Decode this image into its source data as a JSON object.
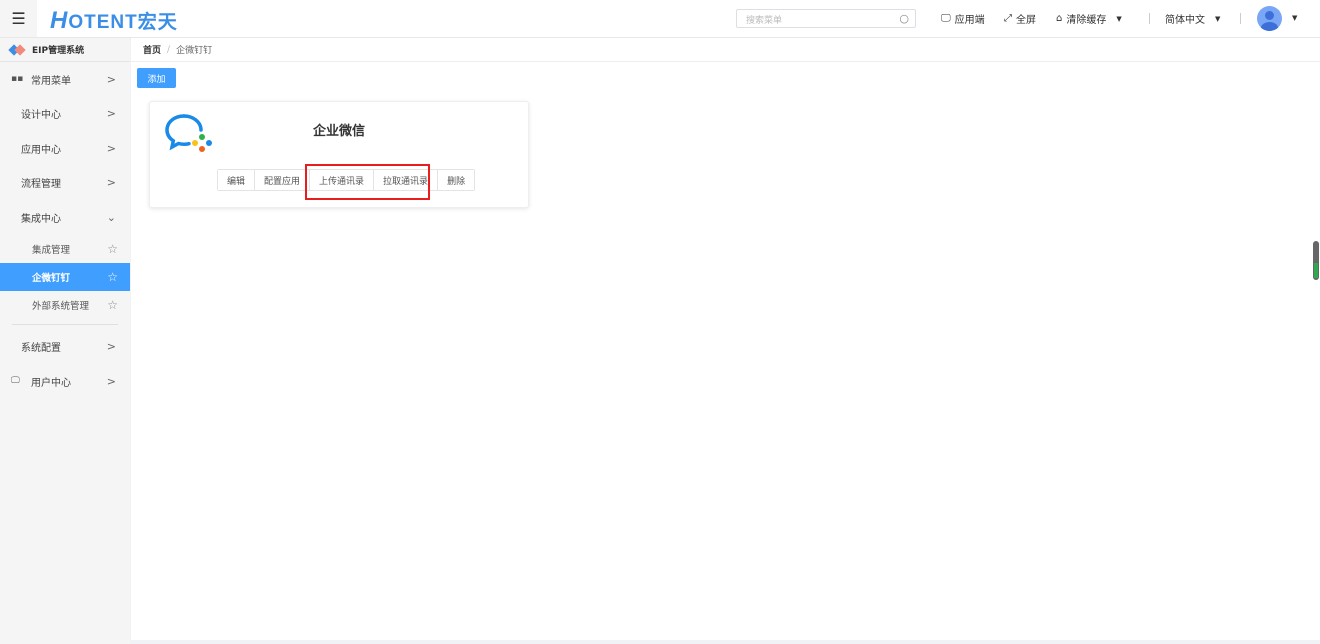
{
  "header": {
    "logo": "HOTENT宏天",
    "logo_initial": "H",
    "logo_rest": "OTENT宏天",
    "search_placeholder": "搜索菜单",
    "app_end": "应用端",
    "fullscreen": "全屏",
    "clear_cache": "清除缓存",
    "language": "简体中文"
  },
  "sidebar": {
    "system": "EIP管理系统",
    "items": [
      {
        "label": "常用菜单"
      },
      {
        "label": "设计中心"
      },
      {
        "label": "应用中心"
      },
      {
        "label": "流程管理"
      },
      {
        "label": "集成中心"
      }
    ],
    "sub_items": [
      {
        "label": "集成管理"
      },
      {
        "label": "企微钉钉"
      },
      {
        "label": "外部系统管理"
      }
    ],
    "items2": [
      {
        "label": "系统配置"
      },
      {
        "label": "用户中心"
      }
    ]
  },
  "breadcrumb": {
    "home": "首页",
    "sep": "/",
    "current": "企微钉钉"
  },
  "toolbar": {
    "add": "添加"
  },
  "card": {
    "title": "企业微信",
    "buttons": [
      "编辑",
      "配置应用",
      "上传通讯录",
      "拉取通讯录",
      "删除"
    ]
  },
  "colors": {
    "accent": "#409eff",
    "highlight": "#e81e1e"
  }
}
